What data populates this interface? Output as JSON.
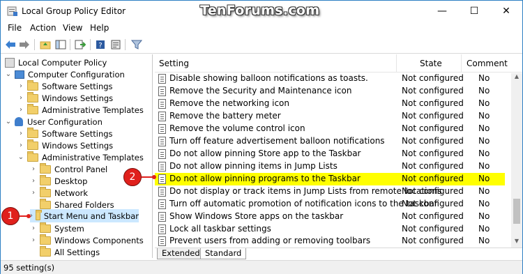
{
  "window": {
    "title": "Local Group Policy Editor",
    "watermark": "TenForums.com",
    "minimize_glyph": "—",
    "maximize_glyph": "☐",
    "close_glyph": "✕"
  },
  "menubar": {
    "items": [
      "File",
      "Action",
      "View",
      "Help"
    ]
  },
  "toolbar": {
    "icons": [
      "back-arrow-icon",
      "forward-arrow-icon",
      "up-folder-icon",
      "show-hide-tree-icon",
      "export-list-icon",
      "help-icon",
      "properties-icon",
      "filter-icon"
    ]
  },
  "tree": {
    "items": [
      {
        "label": "Local Computer Policy"
      },
      {
        "label": "Computer Configuration"
      },
      {
        "label": "Software Settings"
      },
      {
        "label": "Windows Settings"
      },
      {
        "label": "Administrative Templates"
      },
      {
        "label": "User Configuration"
      },
      {
        "label": "Software Settings"
      },
      {
        "label": "Windows Settings"
      },
      {
        "label": "Administrative Templates"
      },
      {
        "label": "Control Panel"
      },
      {
        "label": "Desktop"
      },
      {
        "label": "Network"
      },
      {
        "label": "Shared Folders"
      },
      {
        "label": "Start Menu and Taskbar"
      },
      {
        "label": "System"
      },
      {
        "label": "Windows Components"
      },
      {
        "label": "All Settings"
      }
    ]
  },
  "list": {
    "headers": {
      "setting": "Setting",
      "state": "State",
      "comment": "Comment"
    },
    "rows": [
      {
        "setting": "Disable showing balloon notifications as toasts.",
        "state": "Not configured",
        "comment": "No"
      },
      {
        "setting": "Remove the Security and Maintenance icon",
        "state": "Not configured",
        "comment": "No"
      },
      {
        "setting": "Remove the networking icon",
        "state": "Not configured",
        "comment": "No"
      },
      {
        "setting": "Remove the battery meter",
        "state": "Not configured",
        "comment": "No"
      },
      {
        "setting": "Remove the volume control icon",
        "state": "Not configured",
        "comment": "No"
      },
      {
        "setting": "Turn off feature advertisement balloon notifications",
        "state": "Not configured",
        "comment": "No"
      },
      {
        "setting": "Do not allow pinning Store app to the Taskbar",
        "state": "Not configured",
        "comment": "No"
      },
      {
        "setting": "Do not allow pinning items in Jump Lists",
        "state": "Not configured",
        "comment": "No"
      },
      {
        "setting": "Do not allow pinning programs to the Taskbar",
        "state": "Not configured",
        "comment": "No"
      },
      {
        "setting": "Do not display or track items in Jump Lists from remote locations",
        "state": "Not configured",
        "comment": "No"
      },
      {
        "setting": "Turn off automatic promotion of notification icons to the taskbar",
        "state": "Not configured",
        "comment": "No"
      },
      {
        "setting": "Show Windows Store apps on the taskbar",
        "state": "Not configured",
        "comment": "No"
      },
      {
        "setting": "Lock all taskbar settings",
        "state": "Not configured",
        "comment": "No"
      },
      {
        "setting": "Prevent users from adding or removing toolbars",
        "state": "Not configured",
        "comment": "No"
      }
    ]
  },
  "tabs": [
    "Extended",
    "Standard"
  ],
  "status": "95 setting(s)",
  "callouts": [
    "1",
    "2"
  ],
  "colors": {
    "highlight": "#ffff00",
    "selection": "#cce8ff",
    "callout": "#e0201c"
  }
}
